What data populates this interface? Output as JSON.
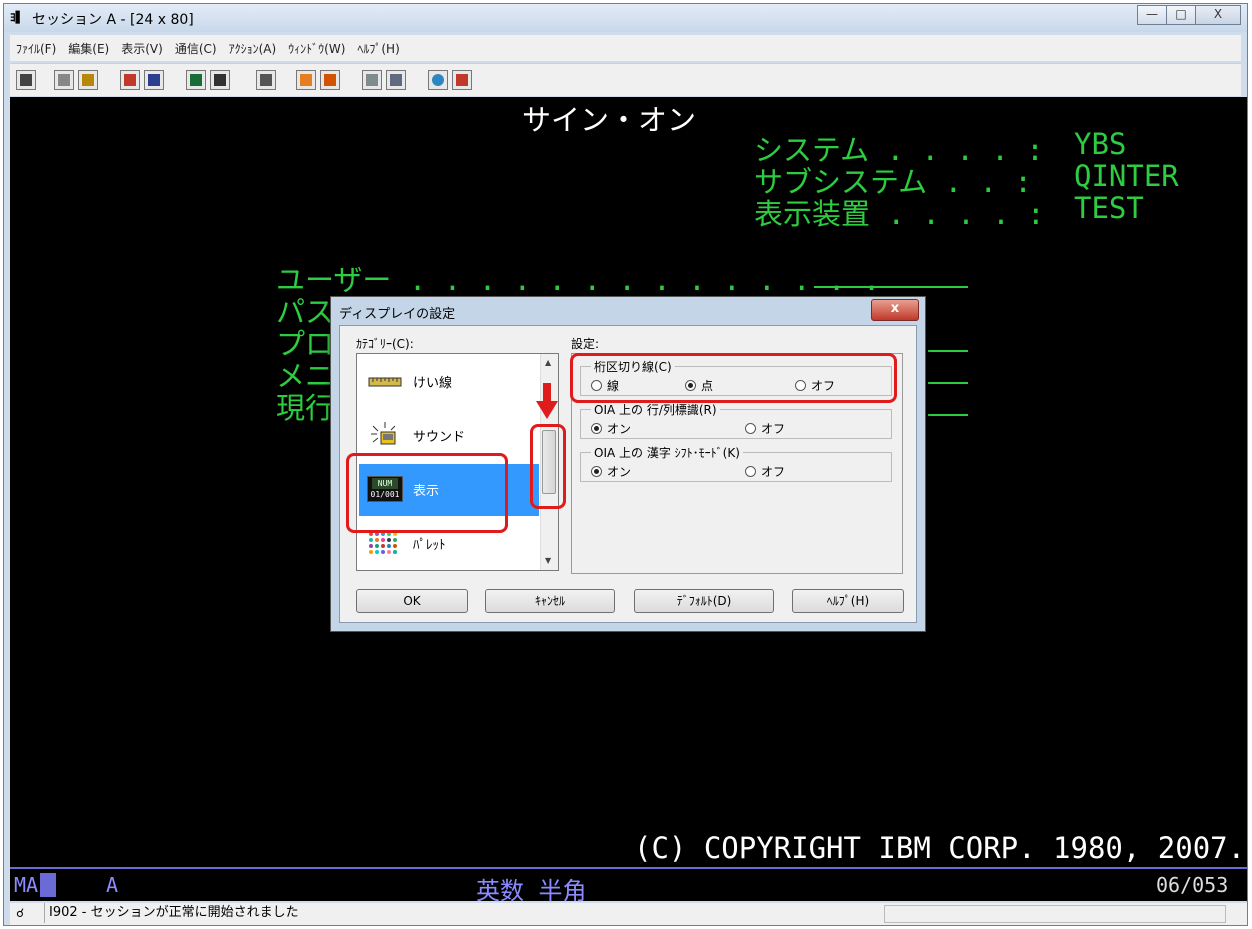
{
  "window": {
    "title": "セッション A - [24 x 80]",
    "minimize": "—",
    "maximize": "□",
    "close": "X"
  },
  "menu": [
    "ﾌｧｲﾙ(F)",
    "編集(E)",
    "表示(V)",
    "通信(C)",
    "ｱｸｼｮﾝ(A)",
    "ｳｨﾝﾄﾞｳ(W)",
    "ﾍﾙﾌﾟ(H)"
  ],
  "terminal": {
    "heading": "サイン・オン",
    "system_label": "システム . . . . :",
    "system_value": "YBS",
    "subsystem_label": "サブシステム . . :",
    "subsystem_value": "QINTER",
    "device_label": "表示装置 . . . . :",
    "device_value": "TEST",
    "user_label": "ユーザー . . . . . . . . . . . . . .",
    "password_label": "パスワ",
    "program_label": "プロ",
    "menu_label": "メニ",
    "current_label": "現行",
    "copyright": "(C) COPYRIGHT IBM CORP. 1980, 2007."
  },
  "oia": {
    "left": "MA",
    "mode": "A",
    "input": "英数 半角",
    "position": "06/053"
  },
  "status": {
    "message": "I902 - セッションが正常に開始されました"
  },
  "dialog": {
    "title": "ディスプレイの設定",
    "close": "x",
    "category_label": "ｶﾃｺﾞﾘｰ(C):",
    "settings_label": "設定:",
    "categories": [
      {
        "name": "けい線",
        "icon": "ruler-icon"
      },
      {
        "name": "サウンド",
        "icon": "sound-icon"
      },
      {
        "name": "表示",
        "icon": "num-display-icon",
        "icon_top": "NUM",
        "icon_bottom": "01/001"
      },
      {
        "name": "ﾊﾟﾚｯﾄ",
        "icon": "palette-icon"
      }
    ],
    "selected_category": "表示",
    "groups": [
      {
        "title": "桁区切り線(C)",
        "options": [
          "線",
          "点",
          "オフ"
        ],
        "selected": "点"
      },
      {
        "title": "OIA 上の 行/列標識(R)",
        "options": [
          "オン",
          "オフ"
        ],
        "selected": "オン"
      },
      {
        "title": "OIA 上の 漢字 ｼﾌﾄ･ﾓｰﾄﾞ(K)",
        "options": [
          "オン",
          "オフ"
        ],
        "selected": "オン"
      }
    ],
    "buttons": {
      "ok": "OK",
      "cancel": "ｷｬﾝｾﾙ",
      "default": "ﾃﾞﾌｫﾙﾄ(D)",
      "help": "ﾍﾙﾌﾟ(H)"
    }
  },
  "colors": {
    "terminal_green": "#2ecc40",
    "terminal_bg": "#000000",
    "oia_blue": "#8b8bff",
    "highlight_red": "#e01b1b",
    "selection_blue": "#3399ff"
  }
}
